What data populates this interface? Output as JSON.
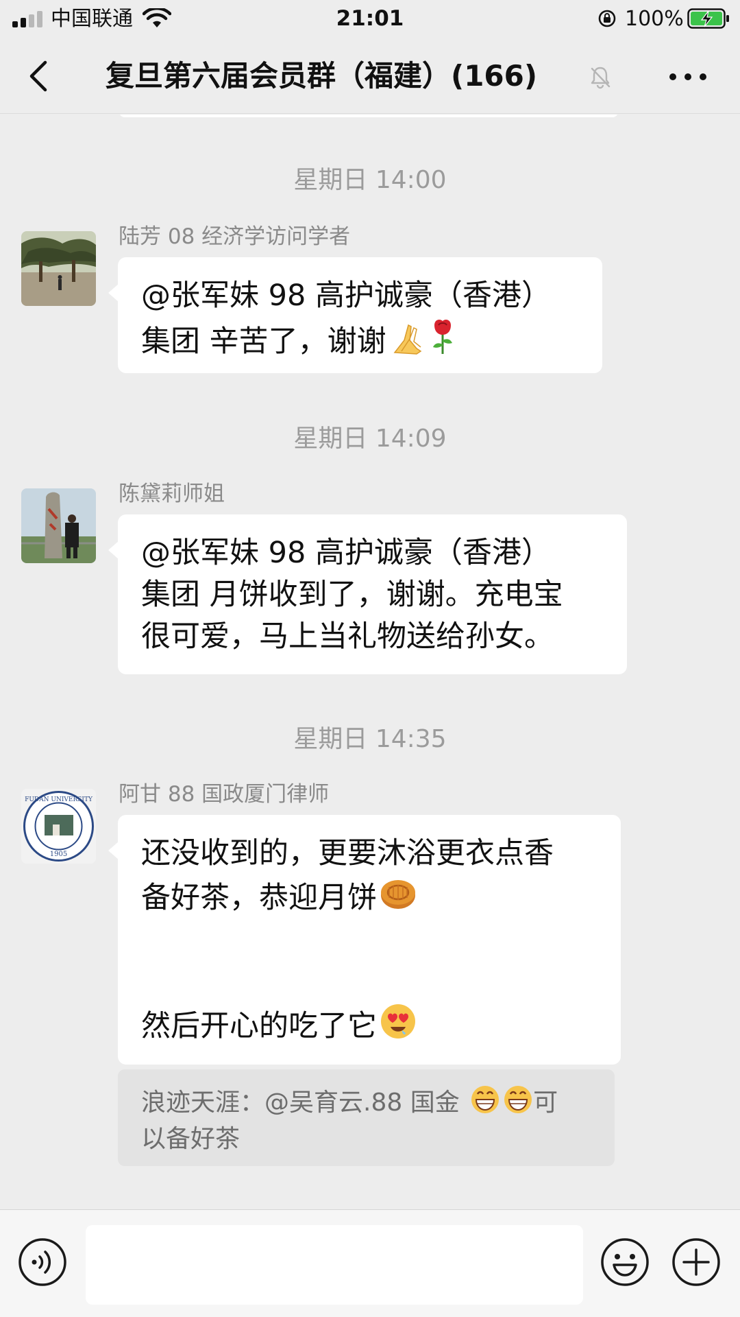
{
  "status_bar": {
    "carrier": "中国联通",
    "time": "21:01",
    "battery": "100%"
  },
  "header": {
    "title": "复旦第六届会员群（福建）(166)"
  },
  "messages": [
    {
      "time": "星期日 14:00",
      "sender": "陆芳 08 经济学访问学者",
      "lines": [
        "@张军妹 98 高护诚豪（香港）",
        "集团 辛苦了，谢谢"
      ],
      "emojis": [
        "praying-hands",
        "rose"
      ]
    },
    {
      "time": "星期日 14:09",
      "sender": "陈黛莉师姐",
      "lines": [
        "@张军妹 98 高护诚豪（香港）",
        "集团 月饼收到了，谢谢。充电宝",
        "很可爱，马上当礼物送给孙女。"
      ]
    },
    {
      "time": "星期日 14:35",
      "sender": "阿甘 88 国政厦门律师",
      "lines": [
        "还没收到的，更要沐浴更衣点香",
        "备好茶，恭迎月饼",
        "然后开心的吃了它"
      ],
      "emojis": [
        "mooncake",
        "drooling-heart-eyes"
      ],
      "avatar_text": "FUDAN UNIVERSITY 1905",
      "quote": {
        "line1_before": "浪迹天涯：@吴育云.88 国金 ",
        "line1_after": "可",
        "line2": "以备好茶"
      }
    }
  ],
  "input": {
    "placeholder": ""
  },
  "colors": {
    "background": "#ededed",
    "bubble": "#ffffff",
    "quote": "#e3e3e3",
    "timestamp": "#9b9b9b",
    "battery_green": "#3bc34a"
  }
}
